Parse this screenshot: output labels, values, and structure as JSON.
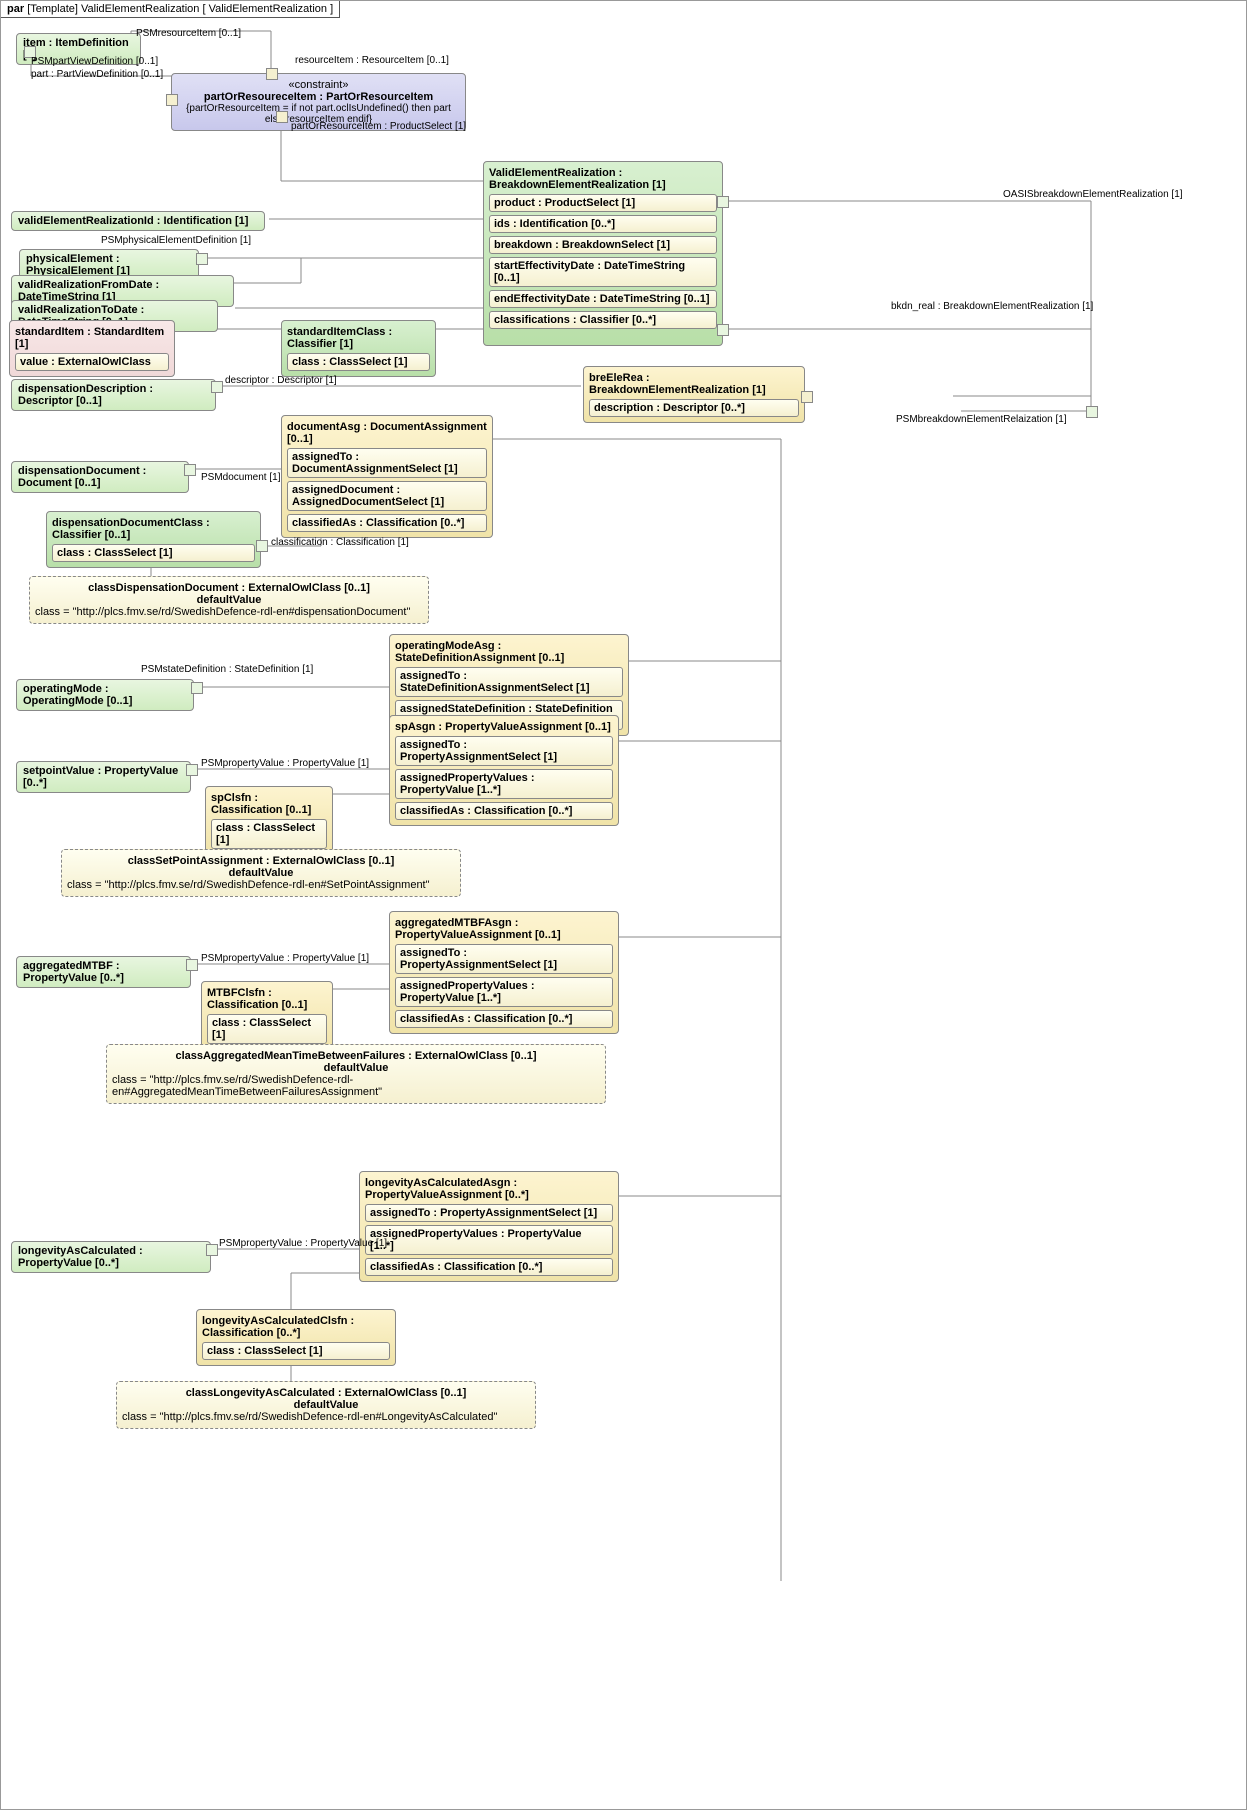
{
  "header": {
    "prefix": "par",
    "bracket1": "[Template]",
    "name": "ValidElementRealization",
    "bracket2": "[ ValidElementRealization ]"
  },
  "item": {
    "title": "item : ItemDefinition [1]"
  },
  "constraint": {
    "st": "«constraint»",
    "title": "partOrResoureceItem : PartOrResourceItem",
    "expr": "{partOrResourceItem = if not part.oclIsUndefined() then part else resourceItem endif}"
  },
  "lbl": {
    "psmres": "PSMresourceItem [0..1]",
    "resitem": "resourceItem : ResourceItem [0..1]",
    "psmpart": "PSMpartViewDefinition [0..1]",
    "part": "part : PartViewDefinition [0..1]",
    "pors": "partOrResourceItem : ProductSelect [1]",
    "oasis": "OASISbreakdownElementRealization [1]",
    "bkdn": "bkdn_real : BreakdownElementRealization [1]",
    "psmber": "PSMbreakdownElementRelaization [1]",
    "psmphys": "PSMphysicalElementDefinition [1]",
    "desc": "descriptor : Descriptor [1]",
    "psmdoc": "PSMdocument [1]",
    "clsf": "classification : Classification [1]",
    "psmstate": "PSMstateDefinition : StateDefinition [1]",
    "psmprop1": "PSMpropertyValue : PropertyValue [1]",
    "psmprop2": "PSMpropertyValue : PropertyValue [1]",
    "psmprop3": "PSMpropertyValue : PropertyValue [1]"
  },
  "ver": {
    "title": "ValidElementRealization : BreakdownElementRealization [1]",
    "r1": "product : ProductSelect [1]",
    "r2": "ids : Identification [0..*]",
    "r3": "breakdown : BreakdownSelect [1]",
    "r4": "startEffectivityDate : DateTimeString [0..1]",
    "r5": "endEffectivityDate : DateTimeString [0..1]",
    "r6": "classifications : Classifier [0..*]"
  },
  "left": {
    "id": "validElementRealizationId : Identification [1]",
    "phys": "physicalElement : PhysicalElement [1]",
    "from": "validRealizationFromDate : DateTimeString [1]",
    "to": "validRealizationToDate : DateTimeString [0..1]",
    "disp": "dispensationDescription : Descriptor [0..1]",
    "doc": "dispensationDocument : Document [0..1]",
    "mode": "operatingMode : OperatingMode [0..1]",
    "sp": "setpointValue : PropertyValue [0..*]",
    "mtbf": "aggregatedMTBF : PropertyValue [0..*]",
    "long": "longevityAsCalculated : PropertyValue [0..*]"
  },
  "std": {
    "title": "standardItem : StandardItem [1]",
    "v": "value : ExternalOwlClass"
  },
  "sic": {
    "title": "standardItemClass : Classifier [1]",
    "v": "class : ClassSelect [1]"
  },
  "bre": {
    "title": "breEleRea : BreakdownElementRealization [1]",
    "v": "description : Descriptor [0..*]"
  },
  "docasg": {
    "title": "documentAsg : DocumentAssignment [0..1]",
    "r1": "assignedTo : DocumentAssignmentSelect [1]",
    "r2": "assignedDocument : AssignedDocumentSelect [1]",
    "r3": "classifiedAs : Classification [0..*]"
  },
  "ddc": {
    "title": "dispensationDocumentClass : Classifier [0..1]",
    "v": "class : ClassSelect [1]"
  },
  "cdd": {
    "title": "classDispensationDocument : ExternalOwlClass [0..1]",
    "dv": "defaultValue",
    "expr": "class = \"http://plcs.fmv.se/rd/SwedishDefence-rdl-en#dispensationDocument\""
  },
  "opasg": {
    "title": "operatingModeAsg : StateDefinitionAssignment [0..1]",
    "r1": "assignedTo : StateDefinitionAssignmentSelect [1]",
    "r2": "assignedStateDefinition : StateDefinition [1]"
  },
  "spasg": {
    "title": "spAsgn : PropertyValueAssignment [0..1]",
    "r1": "assignedTo : PropertyAssignmentSelect [1]",
    "r2": "assignedPropertyValues : PropertyValue [1..*]",
    "r3": "classifiedAs : Classification [0..*]"
  },
  "spc": {
    "title": "spClsfn : Classification [0..1]",
    "v": "class : ClassSelect [1]"
  },
  "csp": {
    "title": "classSetPointAssignment : ExternalOwlClass [0..1]",
    "dv": "defaultValue",
    "expr": "class = \"http://plcs.fmv.se/rd/SwedishDefence-rdl-en#SetPointAssignment\""
  },
  "mtasg": {
    "title": "aggregatedMTBFAsgn : PropertyValueAssignment [0..1]",
    "r1": "assignedTo : PropertyAssignmentSelect [1]",
    "r2": "assignedPropertyValues : PropertyValue [1..*]",
    "r3": "classifiedAs : Classification [0..*]"
  },
  "mtc": {
    "title": "MTBFClsfn : Classification [0..1]",
    "v": "class : ClassSelect [1]"
  },
  "cmt": {
    "title": "classAggregatedMeanTimeBetweenFailures : ExternalOwlClass [0..1]",
    "dv": "defaultValue",
    "expr": "class = \"http://plcs.fmv.se/rd/SwedishDefence-rdl-en#AggregatedMeanTimeBetweenFailuresAssignment\""
  },
  "loasg": {
    "title": "longevityAsCalculatedAsgn : PropertyValueAssignment [0..*]",
    "r1": "assignedTo : PropertyAssignmentSelect [1]",
    "r2": "assignedPropertyValues : PropertyValue [1..*]",
    "r3": "classifiedAs : Classification [0..*]"
  },
  "loc": {
    "title": "longevityAsCalculatedClsfn : Classification [0..*]",
    "v": "class : ClassSelect [1]"
  },
  "clo": {
    "title": "classLongevityAsCalculated : ExternalOwlClass [0..1]",
    "dv": "defaultValue",
    "expr": "class = \"http://plcs.fmv.se/rd/SwedishDefence-rdl-en#LongevityAsCalculated\""
  }
}
